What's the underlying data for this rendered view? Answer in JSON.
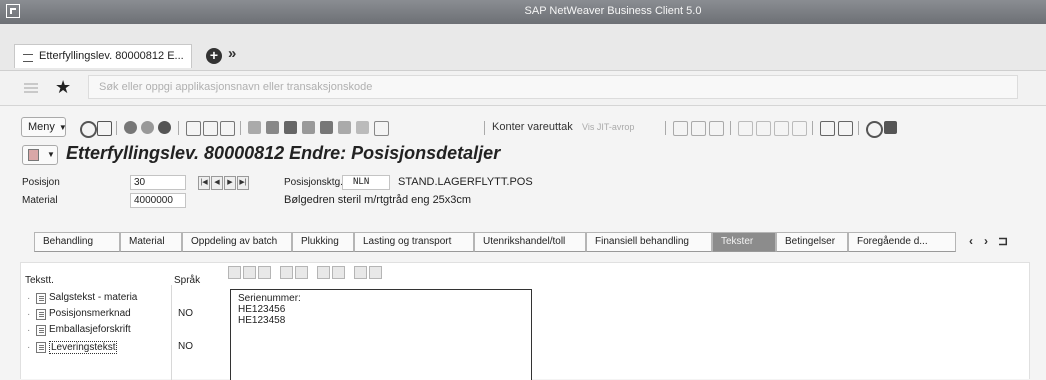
{
  "window": {
    "title": "SAP NetWeaver Business Client 5.0"
  },
  "tabs": [
    {
      "label": "Etterfyllingslev. 80000812 E..."
    }
  ],
  "search": {
    "placeholder": "Søk eller oppgi applikasjonsnavn eller transaksjonskode"
  },
  "toolbar": {
    "menu_label": "Meny",
    "konter_label": "Konter vareuttak",
    "vis_itt_label": "Vis JIT-avrop"
  },
  "page": {
    "title": "Etterfyllingslev. 80000812 Endre: Posisjonsdetaljer"
  },
  "form": {
    "posisjon_label": "Posisjon",
    "posisjon_value": "30",
    "material_label": "Material",
    "material_value": "4000000",
    "posisjonskategori_label": "Posisjonsktg.",
    "posisjonskategori_code": "NLN",
    "posisjonskategori_text": "STAND.LAGERFLYTT.POS",
    "material_description": "Bølgedren steril m/rtgtråd eng 25x3cm"
  },
  "subtabs": [
    {
      "label": "Behandling",
      "active": false
    },
    {
      "label": "Material",
      "active": false
    },
    {
      "label": "Oppdeling av batch",
      "active": false
    },
    {
      "label": "Plukking",
      "active": false
    },
    {
      "label": "Lasting og transport",
      "active": false
    },
    {
      "label": "Utenrikshandel/toll",
      "active": false
    },
    {
      "label": "Finansiell behandling",
      "active": false
    },
    {
      "label": "Tekster",
      "active": true
    },
    {
      "label": "Betingelser",
      "active": false
    },
    {
      "label": "Foregående d...",
      "active": false
    }
  ],
  "texts": {
    "col_text_type": "Tekstt.",
    "col_language": "Språk",
    "rows": [
      {
        "name": "Salgstekst - materia",
        "lang": "",
        "selected": false
      },
      {
        "name": "Posisjonsmerknad",
        "lang": "NO",
        "selected": false
      },
      {
        "name": "Emballasjeforskrift",
        "lang": "",
        "selected": false
      },
      {
        "name": "Leveringstekst",
        "lang": "NO",
        "selected": true
      }
    ],
    "editor_lines": [
      "Serienummer:",
      "HE123456",
      "HE123458"
    ]
  },
  "colors": {
    "active_tab": "#8c8c8c",
    "titlebar": "#7a7d82"
  }
}
